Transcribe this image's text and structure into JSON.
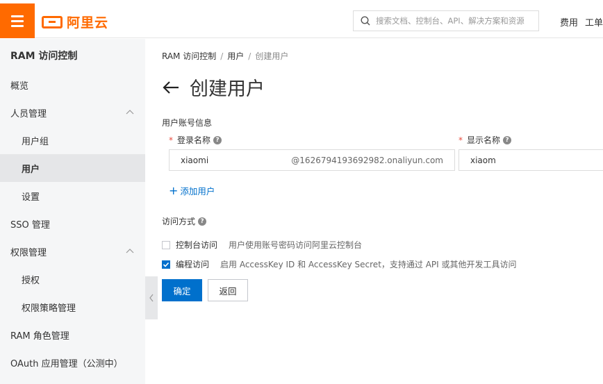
{
  "header": {
    "logo_text": "阿里云",
    "search_placeholder": "搜索文档、控制台、API、解决方案和资源",
    "links": [
      "费用",
      "工单"
    ]
  },
  "sidebar": {
    "title": "RAM 访问控制",
    "items": [
      {
        "label": "概览",
        "level": 0
      },
      {
        "label": "人员管理",
        "level": 0,
        "expanded": true
      },
      {
        "label": "用户组",
        "level": 1
      },
      {
        "label": "用户",
        "level": 1,
        "active": true
      },
      {
        "label": "设置",
        "level": 1
      },
      {
        "label": "SSO 管理",
        "level": 0
      },
      {
        "label": "权限管理",
        "level": 0,
        "expanded": true
      },
      {
        "label": "授权",
        "level": 1
      },
      {
        "label": "权限策略管理",
        "level": 1
      },
      {
        "label": "RAM 角色管理",
        "level": 0
      },
      {
        "label": "OAuth 应用管理（公测中）",
        "level": 0
      }
    ]
  },
  "breadcrumb": [
    "RAM 访问控制",
    "用户",
    "创建用户"
  ],
  "page": {
    "title": "创建用户",
    "account_section": "用户账号信息",
    "login_name_label": "登录名称",
    "login_name_value": "xiaomi",
    "login_suffix": "@1626794193692982.onaliyun.com",
    "display_name_label": "显示名称",
    "display_name_value": "xiaom",
    "add_user": "添加用户",
    "access_section": "访问方式",
    "access_options": [
      {
        "label": "控制台访问",
        "desc": "用户使用账号密码访问阿里云控制台",
        "checked": false
      },
      {
        "label": "编程访问",
        "desc": "启用 AccessKey ID 和 AccessKey Secret，支持通过 API 或其他开发工具访问",
        "checked": true
      }
    ],
    "confirm": "确定",
    "back": "返回"
  },
  "colors": {
    "brand": "#ff6a00",
    "primary": "#0070cc",
    "required": "#e84b3c"
  }
}
